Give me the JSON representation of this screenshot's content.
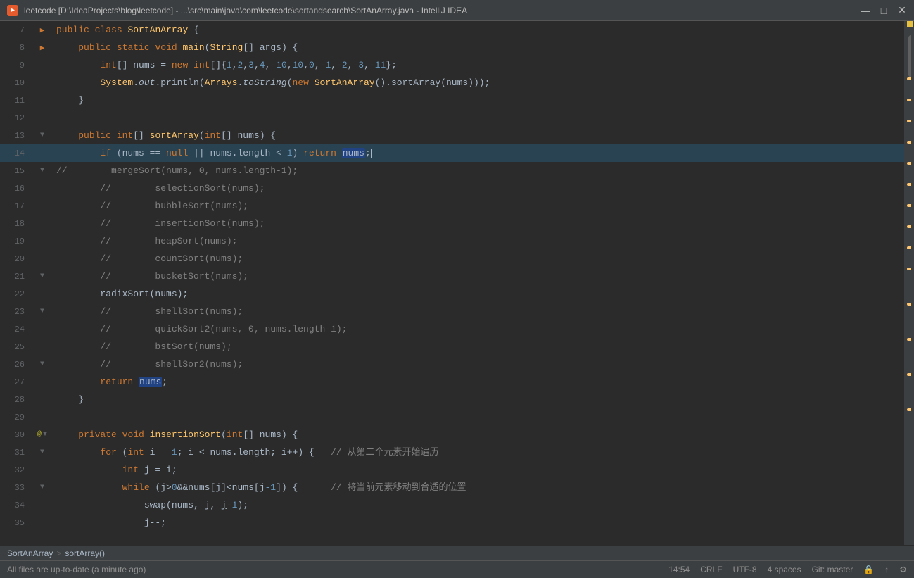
{
  "titleBar": {
    "icon": "▶",
    "title": "leetcode [D:\\IdeaProjects\\blog\\leetcode] - ...\\src\\main\\java\\com\\leetcode\\sortandsearch\\SortAnArray.java - IntelliJ IDEA",
    "minimize": "—",
    "maximize": "□",
    "close": "✕"
  },
  "lines": [
    {
      "num": "7",
      "gutter": "run",
      "content": "public class SortAnArray {"
    },
    {
      "num": "8",
      "gutter": "run",
      "content": "    public static void main(String[] args) {"
    },
    {
      "num": "9",
      "gutter": "",
      "content": "        int[] nums = new int[]{1,2,3,4,-10,10,0,-1,-2,-3,-11};"
    },
    {
      "num": "10",
      "gutter": "",
      "content": "        System.out.println(Arrays.toString(new SortAnArray().sortArray(nums)));"
    },
    {
      "num": "11",
      "gutter": "",
      "content": "    }"
    },
    {
      "num": "12",
      "gutter": "",
      "content": ""
    },
    {
      "num": "13",
      "gutter": "fold",
      "content": "    public int[] sortArray(int[] nums) {"
    },
    {
      "num": "14",
      "gutter": "",
      "content": "        if (nums == null || nums.length < 1) return nums;"
    },
    {
      "num": "15",
      "gutter": "fold-comment",
      "content": "//        mergeSort(nums, 0, nums.length-1);"
    },
    {
      "num": "16",
      "gutter": "comment",
      "content": "//        selectionSort(nums);"
    },
    {
      "num": "17",
      "gutter": "comment",
      "content": "//        bubbleSort(nums);"
    },
    {
      "num": "18",
      "gutter": "comment",
      "content": "//        insertionSort(nums);"
    },
    {
      "num": "19",
      "gutter": "comment",
      "content": "//        heapSort(nums);"
    },
    {
      "num": "20",
      "gutter": "comment",
      "content": "//        countSort(nums);"
    },
    {
      "num": "21",
      "gutter": "fold-comment",
      "content": "//        bucketSort(nums);"
    },
    {
      "num": "22",
      "gutter": "",
      "content": "        radixSort(nums);"
    },
    {
      "num": "23",
      "gutter": "fold-comment",
      "content": "//        shellSort(nums);"
    },
    {
      "num": "24",
      "gutter": "comment",
      "content": "//        quickSort2(nums, 0, nums.length-1);"
    },
    {
      "num": "25",
      "gutter": "comment",
      "content": "//        bstSort(nums);"
    },
    {
      "num": "26",
      "gutter": "fold-comment",
      "content": "//        shellSor2(nums);"
    },
    {
      "num": "27",
      "gutter": "",
      "content": "        return nums;"
    },
    {
      "num": "28",
      "gutter": "",
      "content": "    }"
    },
    {
      "num": "29",
      "gutter": "",
      "content": ""
    },
    {
      "num": "30",
      "gutter": "bookmark-fold",
      "content": "    private void insertionSort(int[] nums) {"
    },
    {
      "num": "31",
      "gutter": "fold",
      "content": "        for (int i = 1; i < nums.length; i++) {   // 从第二个元素开始遍历"
    },
    {
      "num": "32",
      "gutter": "",
      "content": "            int j = i;"
    },
    {
      "num": "33",
      "gutter": "fold",
      "content": "            while (j>0&&nums[j]<nums[j-1]) {      // 将当前元素移动到合适的位置"
    },
    {
      "num": "34",
      "gutter": "",
      "content": "                swap(nums, j, j-1);"
    },
    {
      "num": "35",
      "gutter": "",
      "content": "                j--;"
    }
  ],
  "breadcrumb": {
    "class": "SortAnArray",
    "sep": ">",
    "method": "sortArray()"
  },
  "statusBar": {
    "left": "All files are up-to-date (a minute ago)",
    "time": "14:54",
    "lineEnding": "CRLF",
    "encoding": "UTF-8",
    "indent": "4 spaces",
    "git": "Git: master",
    "lock": "🔒",
    "share": "↑"
  }
}
